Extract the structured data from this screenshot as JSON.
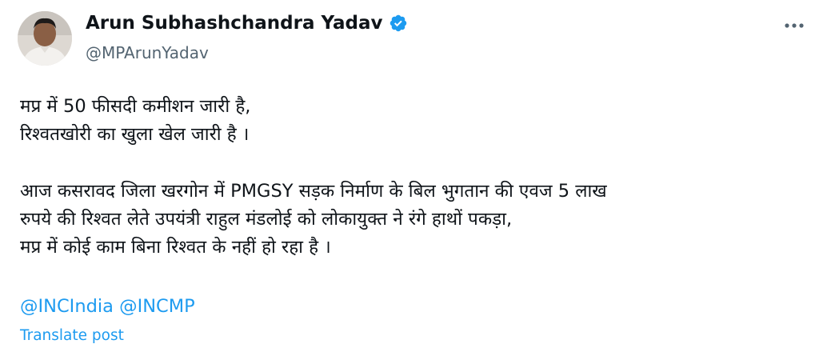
{
  "author": {
    "display_name": "Arun Subhashchandra Yadav",
    "handle": "@MPArunYadav",
    "verified": true
  },
  "post": {
    "lines": [
      "मप्र में 50 फीसदी कमीशन जारी है,",
      "रिश्वतखोरी का खुला खेल जारी है ।",
      "",
      "आज कसरावद जिला खरगोन में PMGSY सड़क निर्माण के बिल भुगतान की एवज 5 लाख",
      "रुपये की रिश्वत लेते उपयंत्री राहुल मंडलोई को लोकायुक्त ने रंगे हाथों पकड़ा,",
      "मप्र में कोई काम बिना रिश्वत के नहीं हो रहा है ।"
    ],
    "mentions": [
      "@INCIndia",
      "@INCMP"
    ]
  },
  "actions": {
    "translate_label": "Translate post",
    "more_icon": "more-horizontal-icon"
  },
  "colors": {
    "link": "#1d9bf0",
    "text": "#0f1419",
    "secondary": "#536471",
    "verified_badge": "#1d9bf0"
  }
}
